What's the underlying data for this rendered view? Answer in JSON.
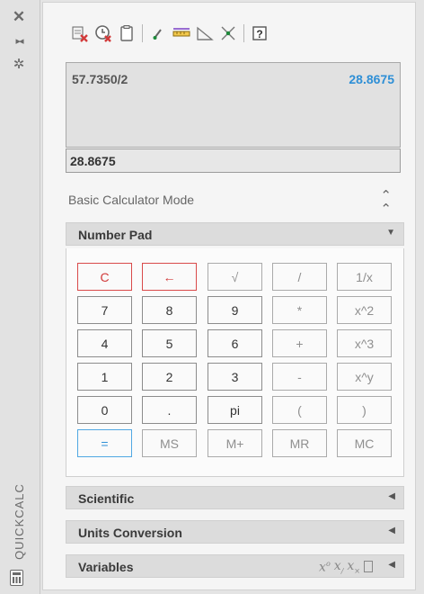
{
  "palette": {
    "title": "QUICKCALC"
  },
  "history": {
    "expression": "57.7350/2",
    "result": "28.8675"
  },
  "input": {
    "value": "28.8675"
  },
  "mode": {
    "label": "Basic Calculator Mode"
  },
  "sections": {
    "number_pad": "Number Pad",
    "scientific": "Scientific",
    "units": "Units Conversion",
    "variables": "Variables"
  },
  "keys": {
    "row1": [
      "C",
      "←",
      "√",
      "/",
      "1/x"
    ],
    "row2": [
      "7",
      "8",
      "9",
      "*",
      "x^2"
    ],
    "row3": [
      "4",
      "5",
      "6",
      "+",
      "x^3"
    ],
    "row4": [
      "1",
      "2",
      "3",
      "-",
      "x^y"
    ],
    "row5": [
      "0",
      ".",
      "pi",
      "(",
      ")"
    ],
    "row6": [
      "=",
      "MS",
      "M+",
      "MR",
      "MC"
    ]
  },
  "colors": {
    "accent_blue": "#2e8fd6",
    "accent_red": "#d13b3b"
  },
  "icons": {
    "strip": [
      "close-icon",
      "auto-hide-icon",
      "properties-icon",
      "calculator-icon"
    ],
    "toolbar": [
      "clear-icon",
      "clear-history-icon",
      "paste-icon",
      "get-coordinates-icon",
      "distance-icon",
      "angle-icon",
      "intersection-icon",
      "help-icon"
    ],
    "variables": [
      "new-variable-icon",
      "edit-variable-icon",
      "delete-variable-icon",
      "calculator-variable-icon"
    ]
  }
}
